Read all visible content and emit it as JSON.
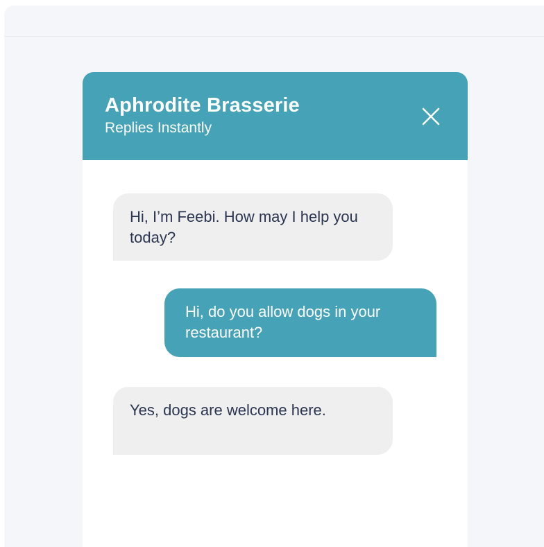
{
  "header": {
    "title": "Aphrodite Brasserie",
    "subtitle": "Replies Instantly",
    "close_icon": "close-icon"
  },
  "messages": [
    {
      "sender": "bot",
      "text": "Hi, I’m Feebi. How may I help you today?"
    },
    {
      "sender": "user",
      "text": "Hi, do you allow dogs in your restaurant?"
    },
    {
      "sender": "bot",
      "text": "Yes, dogs are welcome here."
    }
  ],
  "colors": {
    "accent": "#46a3b7",
    "bot_bubble": "#efefef",
    "bot_text": "#2b3550",
    "page_background": "#f5f6f9"
  }
}
